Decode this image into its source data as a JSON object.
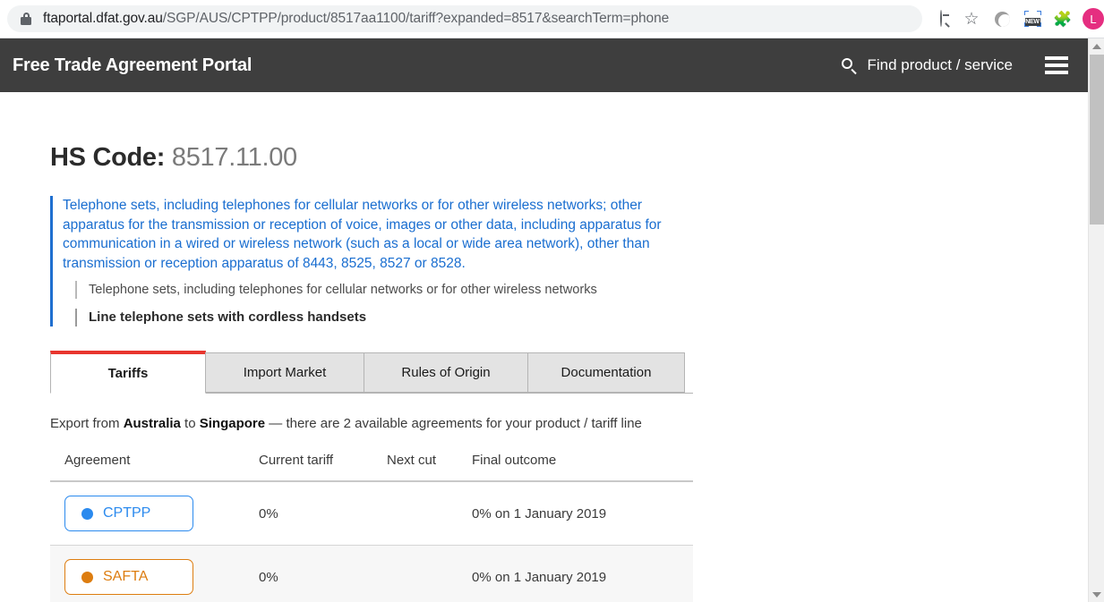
{
  "browser": {
    "lock_icon": "lock-icon",
    "url_domain": "ftaportal.dfat.gov.au",
    "url_path": "/SGP/AUS/CPTPP/product/8517aa1100/tariff?expanded=8517&searchTerm=phone",
    "icons": {
      "zoom_out": "zoom-out-icon",
      "bookmark": "star-icon",
      "crescent": "crescent-icon",
      "new_badge": "NEW",
      "extensions": "puzzle-icon",
      "profile_initial": "L",
      "menu": "kebab-menu-icon"
    }
  },
  "site_header": {
    "title": "Free Trade Agreement Portal",
    "search_label": "Find product / service",
    "search_icon": "search-icon",
    "menu_icon": "hamburger-icon"
  },
  "page": {
    "hs_code_label": "HS Code:",
    "hs_code_value": "8517.11.00",
    "description_primary": "Telephone sets, including telephones for cellular networks or for other wireless networks; other apparatus for the transmission or reception of voice, images or other data, including apparatus for communication in a wired or wireless network (such as a local or wide area network), other than transmission or reception apparatus of 8443, 8525, 8527 or 8528.",
    "description_secondary": "Telephone sets, including telephones for cellular networks or for other wireless networks",
    "description_tertiary": "Line telephone sets with cordless handsets"
  },
  "tabs": [
    {
      "label": "Tariffs",
      "active": true
    },
    {
      "label": "Import Market",
      "active": false
    },
    {
      "label": "Rules of Origin",
      "active": false
    },
    {
      "label": "Documentation",
      "active": false
    }
  ],
  "export_line": {
    "prefix": "Export from ",
    "origin": "Australia",
    "middle": " to ",
    "destination": "Singapore",
    "suffix": " — there are 2 available agreements for your product / tariff line"
  },
  "table": {
    "headers": [
      "Agreement",
      "Current tariff",
      "Next cut",
      "Final outcome"
    ],
    "rows": [
      {
        "agreement": "CPTPP",
        "dot_color": "#2b8aee",
        "current_tariff": "0%",
        "next_cut": "",
        "final_outcome": "0% on 1 January 2019"
      },
      {
        "agreement": "SAFTA",
        "dot_color": "#dd7d10",
        "current_tariff": "0%",
        "next_cut": "",
        "final_outcome": "0% on 1 January 2019"
      }
    ]
  },
  "colors": {
    "header_bg": "#3e3e3e",
    "link_blue": "#1a6ed0",
    "active_tab_accent": "#e8352e",
    "cptpp": "#2b8aee",
    "safta": "#dd7d10"
  }
}
